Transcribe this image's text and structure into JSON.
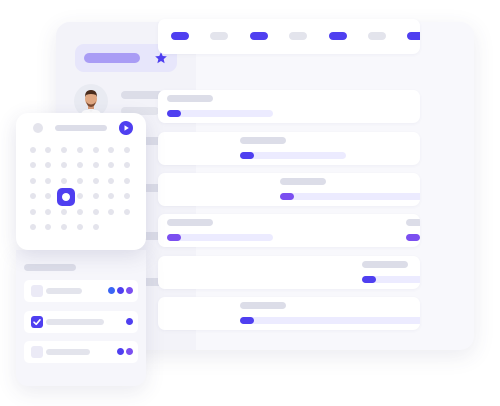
{
  "colors": {
    "accent_indigo": "#4f3ff0",
    "accent_violet": "#7b4ff0",
    "accent_blue": "#3b66f5",
    "placeholder_gray": "#dcdde8",
    "track_lavender": "#ecebff",
    "panel_bg": "#f6f6fb"
  },
  "sidebar": {
    "header_icon": "star-icon",
    "avatar_icon": "avatar-icon"
  },
  "calendar": {
    "header_icon": "play-icon",
    "selected_icon": "selected-day-marker"
  },
  "tasks": [
    {
      "checked": false,
      "status_dots": [
        "#3b66f5",
        "#4f3ff0",
        "#7b4ff0"
      ]
    },
    {
      "checked": true,
      "status_dots": [
        "#4f3ff0"
      ]
    },
    {
      "checked": false,
      "status_dots": [
        "#4f3ff0",
        "#7b4ff0"
      ]
    }
  ]
}
